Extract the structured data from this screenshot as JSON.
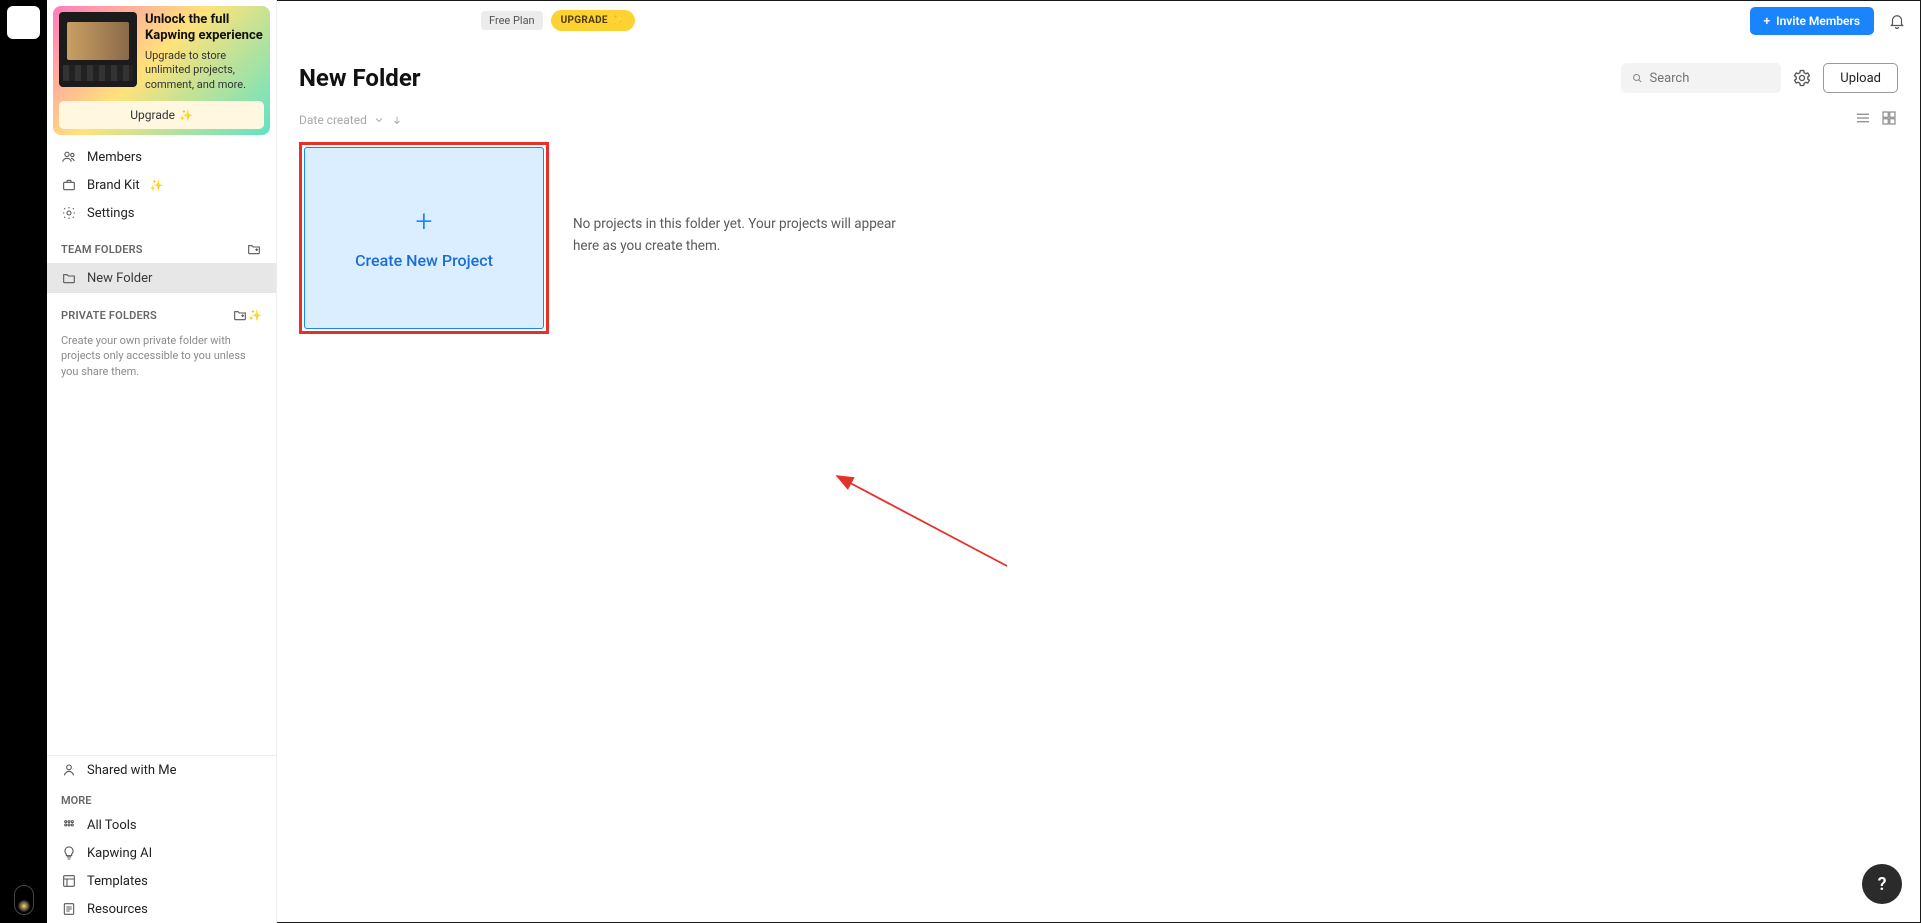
{
  "topbar": {
    "free_badge": "Free Plan",
    "upgrade_badge": "UPGRADE",
    "invite_label": "Invite Members"
  },
  "promo": {
    "title": "Unlock the full Kapwing experience",
    "subtitle": "Upgrade to store unlimited projects, comment, and more.",
    "button": "Upgrade"
  },
  "sidebar": {
    "members": "Members",
    "brand_kit": "Brand Kit",
    "settings": "Settings",
    "team_folders_header": "TEAM FOLDERS",
    "team_folder_name": "New Folder",
    "private_folders_header": "PRIVATE FOLDERS",
    "private_hint": "Create your own private folder with projects only accessible to you unless you share them.",
    "shared_with_me": "Shared with Me",
    "more_header": "MORE",
    "all_tools": "All Tools",
    "kapwing_ai": "Kapwing AI",
    "templates": "Templates",
    "resources": "Resources"
  },
  "main": {
    "title": "New Folder",
    "search_placeholder": "Search",
    "upload_label": "Upload",
    "sort_label": "Date created",
    "create_card_label": "Create New Project",
    "empty_message": "No projects in this folder yet. Your projects will appear here as you create them."
  },
  "help": {
    "label": "?"
  }
}
